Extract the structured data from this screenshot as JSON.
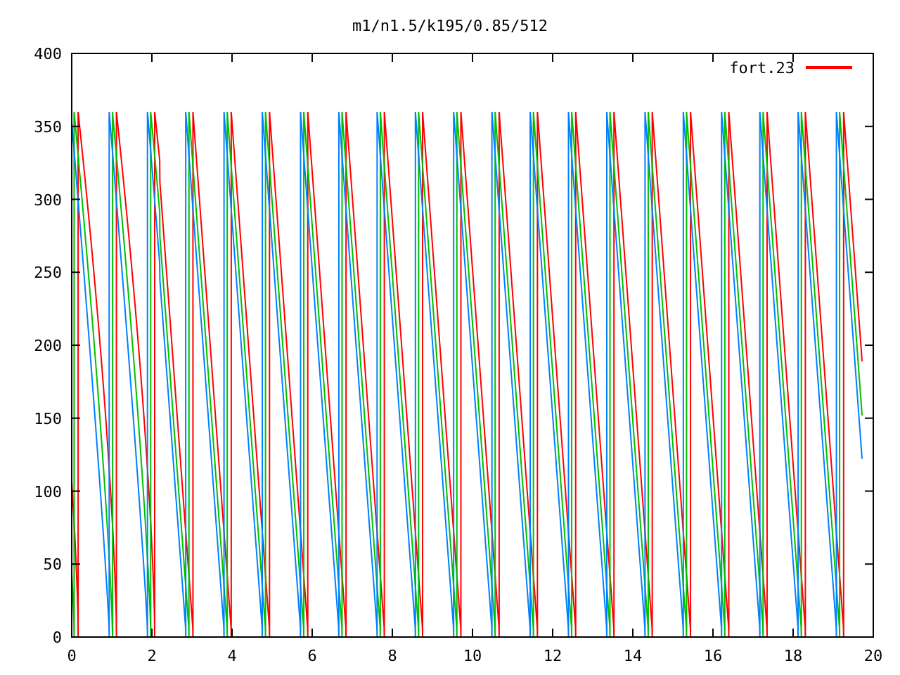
{
  "plot": {
    "title": "m1/n1.5/k195/0.85/512",
    "y_ticks": [
      "400",
      "350",
      "300",
      "250",
      "200",
      "150",
      "100",
      "50",
      "0"
    ],
    "x_ticks": [
      "0",
      "2",
      "4",
      "6",
      "8",
      "10",
      "12",
      "14",
      "16",
      "18",
      "20"
    ],
    "legend": {
      "label": "fort.23",
      "color": "#ff0000"
    }
  }
}
